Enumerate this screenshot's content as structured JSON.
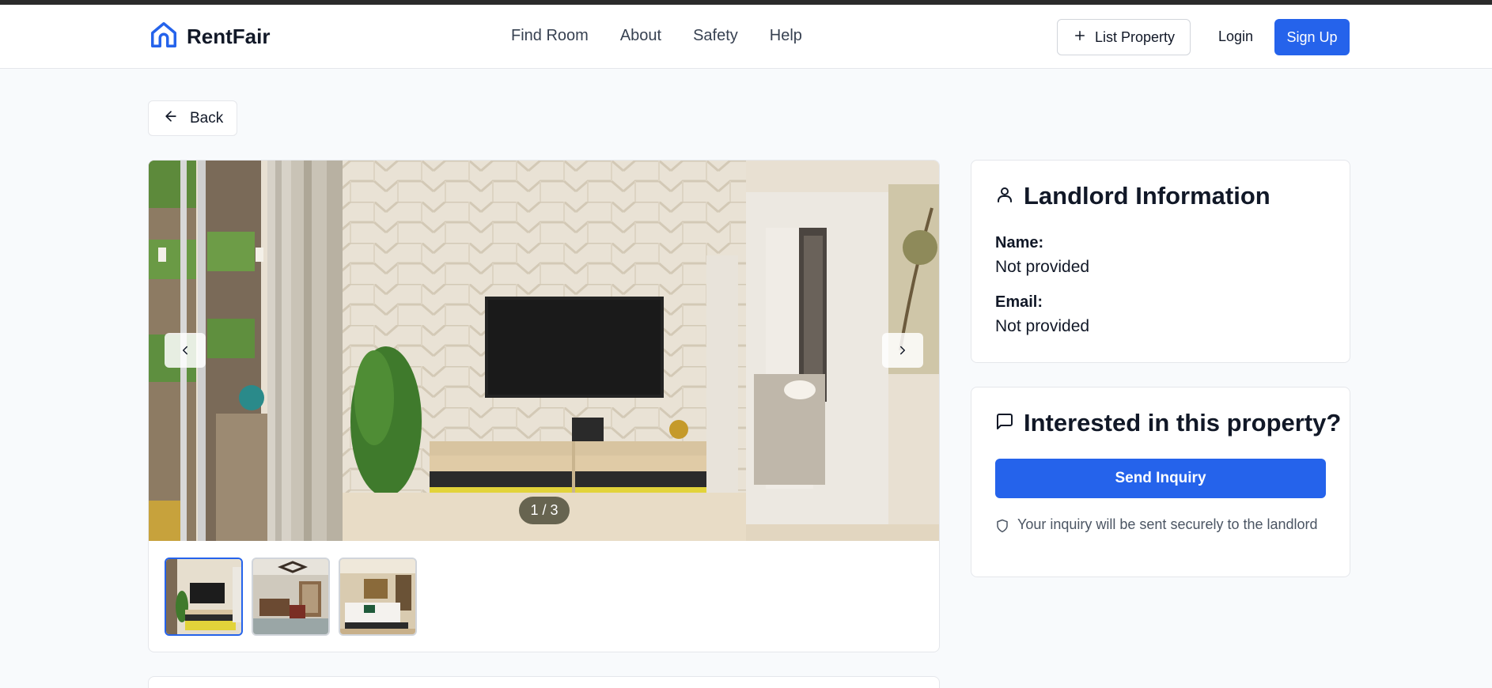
{
  "brand": {
    "name": "RentFair",
    "icon": "house-icon",
    "color": "#2563eb"
  },
  "nav": {
    "links": [
      "Find Room",
      "About",
      "Safety",
      "Help"
    ]
  },
  "header_actions": {
    "list_property": "List Property",
    "login": "Login",
    "signup": "Sign Up"
  },
  "back": {
    "label": "Back"
  },
  "gallery": {
    "counter": "1 / 3",
    "current_index": 1,
    "total": 3,
    "thumbnails": [
      "living-room-tv",
      "dining-room",
      "bedroom"
    ]
  },
  "landlord": {
    "title": "Landlord Information",
    "name_label": "Name:",
    "name_value": "Not provided",
    "email_label": "Email:",
    "email_value": "Not provided"
  },
  "inquiry": {
    "title": "Interested in this property?",
    "button": "Send Inquiry",
    "note": "Your inquiry will be sent securely to the landlord"
  },
  "colors": {
    "primary": "#2563eb",
    "background": "#f8fafc",
    "text": "#111827",
    "muted": "#4b5563"
  }
}
